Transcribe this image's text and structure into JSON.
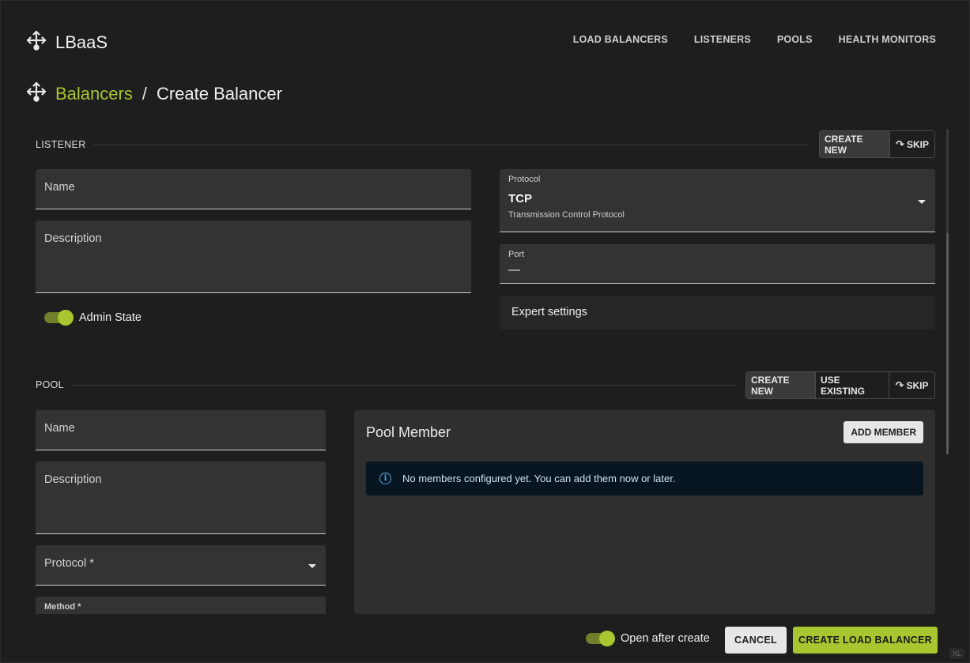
{
  "app": {
    "name": "LBaaS"
  },
  "nav": {
    "items": [
      "LOAD BALANCERS",
      "LISTENERS",
      "POOLS",
      "HEALTH MONITORS"
    ]
  },
  "breadcrumb": {
    "parent": "Balancers",
    "separator": "/",
    "current": "Create Balancer"
  },
  "listener": {
    "title": "LISTENER",
    "actions": {
      "create_new": "CREATE NEW",
      "skip": "SKIP"
    },
    "name_label": "Name",
    "description_label": "Description",
    "admin_state_label": "Admin State",
    "admin_state_on": true,
    "protocol_label": "Protocol",
    "protocol_value": "TCP",
    "protocol_desc": "Transmission Control Protocol",
    "port_label": "Port",
    "port_value": "—",
    "expert_label": "Expert settings"
  },
  "pool": {
    "title": "POOL",
    "actions": {
      "create_new": "CREATE NEW",
      "use_existing": "USE EXISTING",
      "skip": "SKIP"
    },
    "name_label": "Name",
    "description_label": "Description",
    "protocol_label": "Protocol *",
    "method_label": "Method *",
    "member_panel_title": "Pool Member",
    "add_member": "ADD MEMBER",
    "empty_message": "No members configured yet. You can add them now or later."
  },
  "footer": {
    "open_after_create_label": "Open after create",
    "open_after_create_on": true,
    "cancel": "CANCEL",
    "create": "CREATE LOAD BALANCER"
  },
  "corner_badge": "XL",
  "colors": {
    "accent": "#a8c62f",
    "background": "#1e1e1e",
    "field": "#333333",
    "alert_bg": "#071521",
    "info": "#4fa9e0"
  }
}
